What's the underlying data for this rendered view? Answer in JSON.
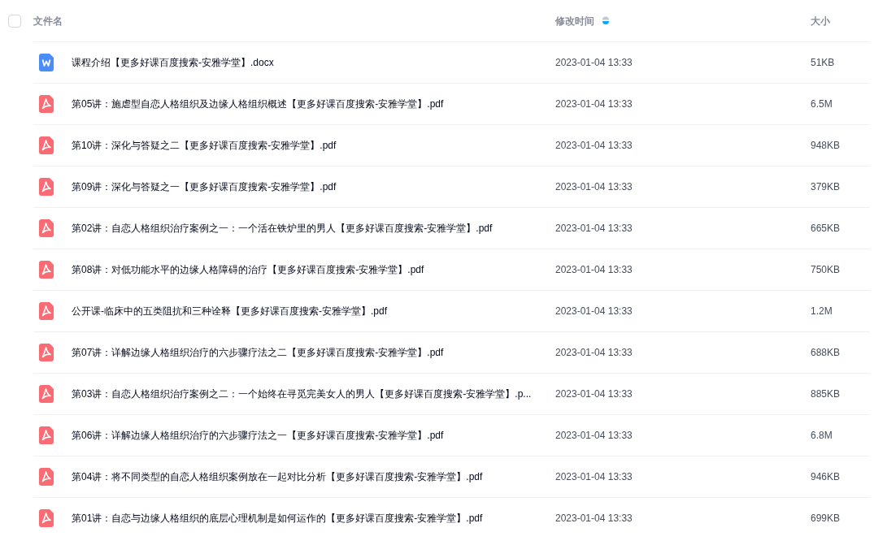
{
  "header": {
    "select_all_checked": false,
    "columns": [
      {
        "label": "文件名"
      },
      {
        "label": "修改时间",
        "sorted_descending": true
      },
      {
        "label": "大小"
      }
    ]
  },
  "rows": [
    {
      "kind": "word",
      "name": "课程介绍【更多好课百度搜索-安雅学堂】.docx",
      "modified": "2023-01-04 13:33",
      "size": "51KB"
    },
    {
      "kind": "pdf",
      "name": "第05讲：施虐型自恋人格组织及边缘人格组织概述【更多好课百度搜索-安雅学堂】.pdf",
      "modified": "2023-01-04 13:33",
      "size": "6.5M"
    },
    {
      "kind": "pdf",
      "name": "第10讲：深化与答疑之二【更多好课百度搜索-安雅学堂】.pdf",
      "modified": "2023-01-04 13:33",
      "size": "948KB"
    },
    {
      "kind": "pdf",
      "name": "第09讲：深化与答疑之一【更多好课百度搜索-安雅学堂】.pdf",
      "modified": "2023-01-04 13:33",
      "size": "379KB"
    },
    {
      "kind": "pdf",
      "name": "第02讲：自恋人格组织治疗案例之一：一个活在铁炉里的男人【更多好课百度搜索-安雅学堂】.pdf",
      "modified": "2023-01-04 13:33",
      "size": "665KB"
    },
    {
      "kind": "pdf",
      "name": "第08讲：对低功能水平的边缘人格障碍的治疗【更多好课百度搜索-安雅学堂】.pdf",
      "modified": "2023-01-04 13:33",
      "size": "750KB"
    },
    {
      "kind": "pdf",
      "name": "公开课-临床中的五类阻抗和三种诠释【更多好课百度搜索-安雅学堂】.pdf",
      "modified": "2023-01-04 13:33",
      "size": "1.2M"
    },
    {
      "kind": "pdf",
      "name": "第07讲：详解边缘人格组织治疗的六步骤疗法之二【更多好课百度搜索-安雅学堂】.pdf",
      "modified": "2023-01-04 13:33",
      "size": "688KB"
    },
    {
      "kind": "pdf",
      "name": "第03讲：自恋人格组织治疗案例之二：一个始终在寻觅完美女人的男人【更多好课百度搜索-安雅学堂】.p...",
      "modified": "2023-01-04 13:33",
      "size": "885KB"
    },
    {
      "kind": "pdf",
      "name": "第06讲：详解边缘人格组织治疗的六步骤疗法之一【更多好课百度搜索-安雅学堂】.pdf",
      "modified": "2023-01-04 13:33",
      "size": "6.8M"
    },
    {
      "kind": "pdf",
      "name": "第04讲：将不同类型的自恋人格组织案例放在一起对比分析【更多好课百度搜索-安雅学堂】.pdf",
      "modified": "2023-01-04 13:33",
      "size": "946KB"
    },
    {
      "kind": "pdf",
      "name": "第01讲：自恋与边缘人格组织的底层心理机制是如何运作的【更多好课百度搜索-安雅学堂】.pdf",
      "modified": "2023-01-04 13:33",
      "size": "699KB"
    }
  ]
}
